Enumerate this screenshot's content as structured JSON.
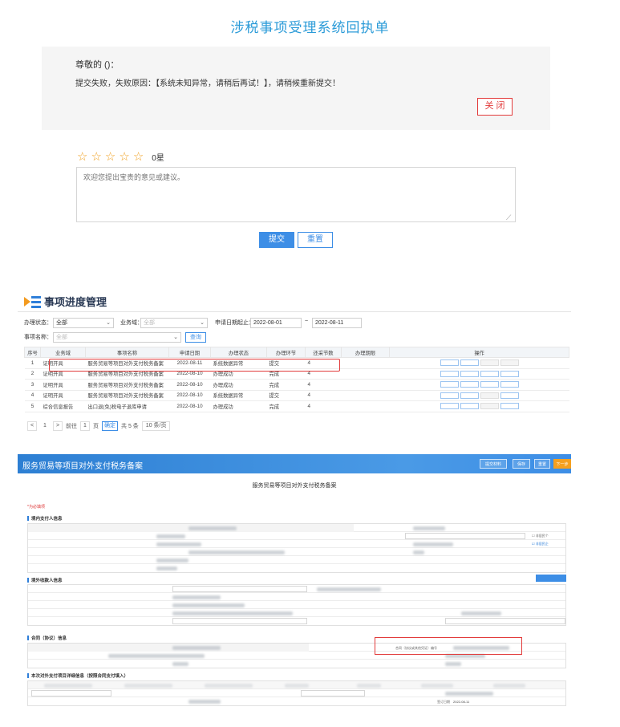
{
  "receipt": {
    "title": "涉税事项受理系统回执单",
    "greeting": "尊敬的 ()：",
    "message": "提交失败，失败原因：【系统未知异常，请稍后再试！】，请稍候重新提交！",
    "close_label": "关 闭",
    "rating": {
      "stars": 5,
      "filled": 0,
      "score_text": "0星"
    },
    "comment_placeholder": "欢迎您提出宝贵的意见或建议。",
    "submit_label": "提交",
    "reset_label": "重置"
  },
  "progress": {
    "title": "事项进度管理",
    "filters": {
      "status_label": "办理状态：",
      "status_value": "全部",
      "business_label": "业务域：",
      "business_value": "全部",
      "date_label": "申请日期起止：",
      "date_from": "2022-08-01",
      "date_sep": "~",
      "date_to": "2022-08-11",
      "item_label": "事项名称：",
      "item_value": "全部",
      "query_label": "查询"
    },
    "columns": [
      "序号",
      "业务域",
      "事项名称",
      "申请日期",
      "办理状态",
      "办理环节",
      "还采节数",
      "办理期限",
      "操作"
    ],
    "rows": [
      [
        "1",
        "证明开具",
        "服务贸易等项目对外支付税务备案",
        "2022-08-11",
        "系统数据异常",
        "提交",
        "4",
        "",
        ""
      ],
      [
        "2",
        "证明开具",
        "服务贸易等项目对外支付税务备案",
        "2022-08-10",
        "办理成功",
        "完成",
        "4",
        "",
        ""
      ],
      [
        "3",
        "证明开具",
        "服务贸易等项目对外支付税务备案",
        "2022-08-10",
        "办理成功",
        "完成",
        "4",
        "",
        ""
      ],
      [
        "4",
        "证明开具",
        "服务贸易等项目对外支付税务备案",
        "2022-08-10",
        "系统数据异常",
        "提交",
        "4",
        "",
        ""
      ],
      [
        "5",
        "综合信息报告",
        "出口退(免)税电子退库申请",
        "2022-08-10",
        "办理成功",
        "完成",
        "4",
        "",
        ""
      ]
    ],
    "pager": {
      "prev": "<",
      "page": "1",
      "next": ">",
      "goto_label": "前往",
      "goto_value": "1",
      "page_unit": "页",
      "confirm": "确定",
      "total_text": "共 5 条",
      "page_size": "10 条/页"
    }
  },
  "filing": {
    "title": "服务贸易等项目对外支付税务备案",
    "toolbar": [
      "提交材料",
      "保存",
      "重置",
      "下一步"
    ],
    "form_title": "服务贸易等项目对外支付税务备案",
    "required_note": "*为必填项",
    "sections": {
      "payer": "境内支付人信息",
      "payee": "境外收款人信息",
      "contract": "合同（协议）信息",
      "payment": "本次对外支付项目详细信息（按照合同支付填入）"
    },
    "contract_highlight_label": "合同（协议或其他凭证）编号",
    "contract_date_label": "签订日期",
    "contract_date_value": "2022-08-11",
    "checkbox_labels": [
      "非居民个",
      "非居民企"
    ]
  }
}
